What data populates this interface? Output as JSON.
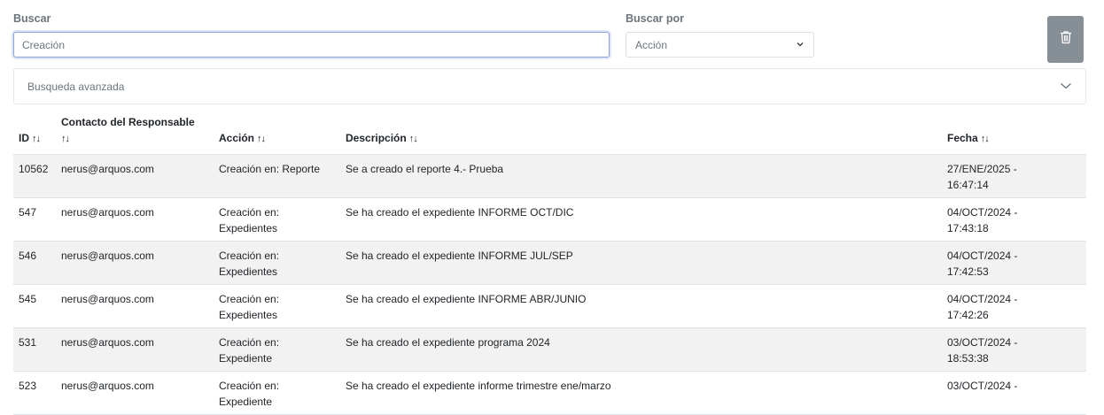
{
  "search": {
    "label": "Buscar",
    "value": "Creación"
  },
  "search_by": {
    "label": "Buscar por",
    "selected": "Acción"
  },
  "advanced_search": {
    "label": "Busqueda avanzada"
  },
  "table": {
    "sort_glyph": "↑↓",
    "columns": [
      "ID",
      "Contacto del Responsable",
      "Acción",
      "Descripción",
      "Fecha"
    ],
    "rows": [
      {
        "id": "10562",
        "contact": "nerus@arquos.com",
        "action": "Creación en: Reporte",
        "description": "Se a creado el reporte 4.- Prueba",
        "date": "27/ENE/2025 -",
        "time": "16:47:14"
      },
      {
        "id": "547",
        "contact": "nerus@arquos.com",
        "action": "Creación en: Expedientes",
        "description": "Se ha creado el expediente INFORME OCT/DIC",
        "date": "04/OCT/2024 -",
        "time": "17:43:18"
      },
      {
        "id": "546",
        "contact": "nerus@arquos.com",
        "action": "Creación en: Expedientes",
        "description": "Se ha creado el expediente INFORME JUL/SEP",
        "date": "04/OCT/2024 -",
        "time": "17:42:53"
      },
      {
        "id": "545",
        "contact": "nerus@arquos.com",
        "action": "Creación en: Expedientes",
        "description": "Se ha creado el expediente INFORME ABR/JUNIO",
        "date": "04/OCT/2024 -",
        "time": "17:42:26"
      },
      {
        "id": "531",
        "contact": "nerus@arquos.com",
        "action": "Creación en: Expediente",
        "description": "Se ha creado el expediente programa 2024",
        "date": "03/OCT/2024 -",
        "time": "18:53:38"
      },
      {
        "id": "523",
        "contact": "nerus@arquos.com",
        "action": "Creación en: Expediente",
        "description": "Se ha creado el expediente informe trimestre ene/marzo",
        "date": "03/OCT/2024 -",
        "time": ""
      }
    ]
  },
  "colors": {
    "delete_button": "#868e96",
    "striped_row": "#f2f2f2"
  },
  "icons": {
    "delete": "trash-icon",
    "select": "chevron-down-icon",
    "advanced": "chevron-down-icon"
  }
}
